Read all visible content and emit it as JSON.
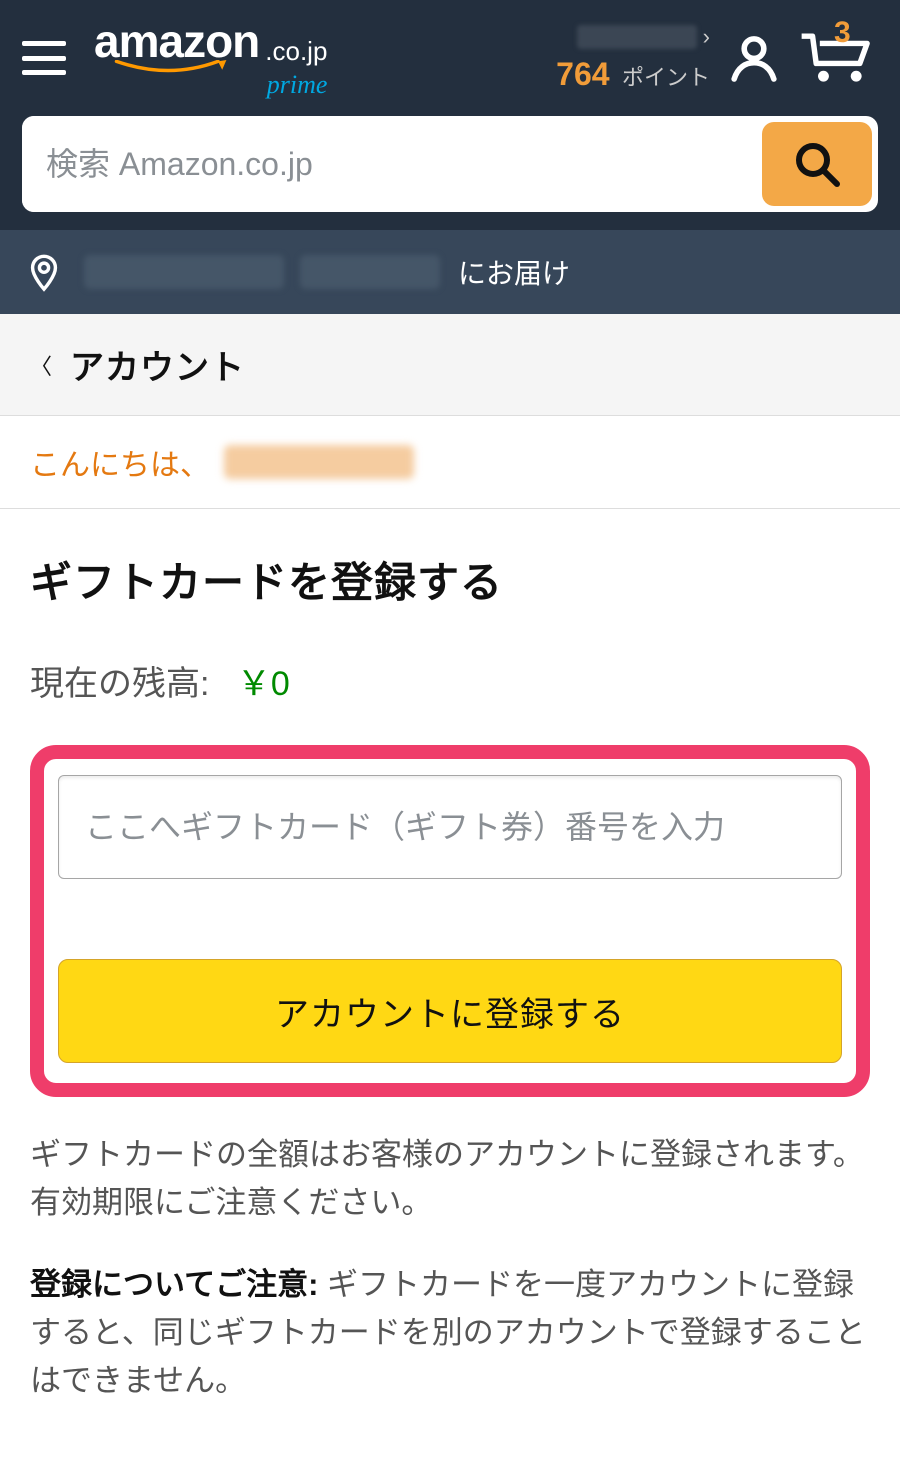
{
  "header": {
    "logo_text": "amazon",
    "logo_domain": ".co.jp",
    "logo_subbrand": "prime",
    "points_value": "764",
    "points_label": "ポイント",
    "cart_count": "3",
    "name_caret": "›"
  },
  "search": {
    "placeholder": "検索 Amazon.co.jp"
  },
  "address_bar": {
    "suffix": "にお届け"
  },
  "breadcrumb": {
    "label": "アカウント"
  },
  "greeting": {
    "prefix": "こんにちは、"
  },
  "main": {
    "title": "ギフトカードを登録する",
    "balance_label": "現在の残高:",
    "balance_value": "￥0",
    "input_placeholder": "ここへギフトカード（ギフト券）番号を入力",
    "register_button": "アカウントに登録する",
    "note1": "ギフトカードの全額はお客様のアカウントに登録されます。有効期限にご注意ください。",
    "note2_strong": "登録についてご注意:",
    "note2_rest": " ギフトカードを一度アカウントに登録すると、同じギフトカードを別のアカウントで登録することはできません。"
  }
}
